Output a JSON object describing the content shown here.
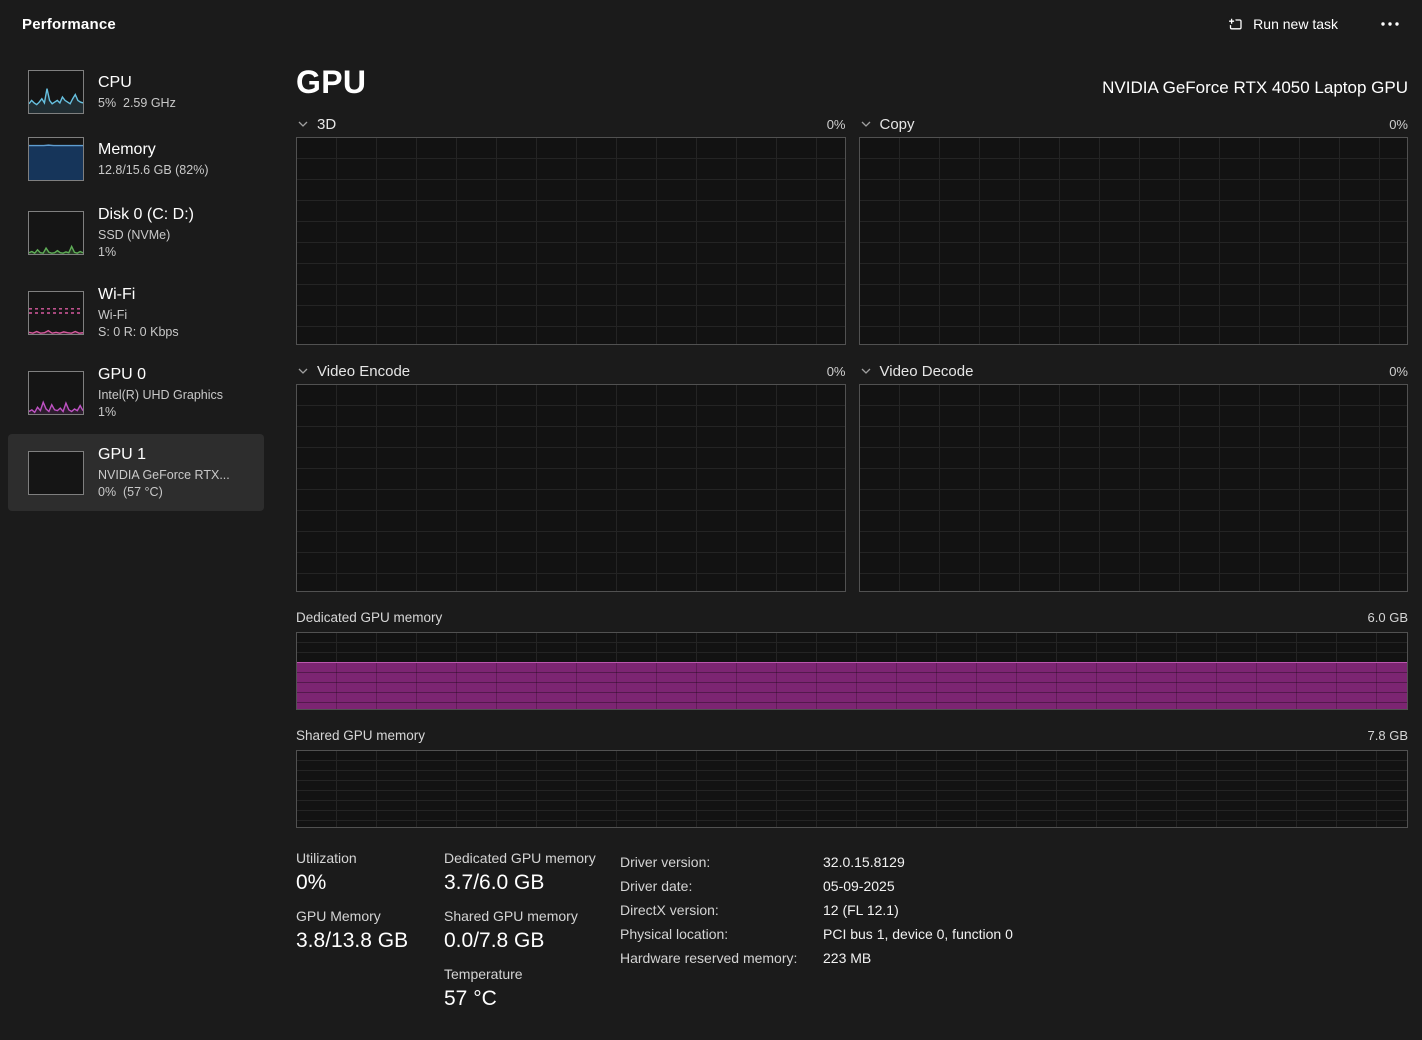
{
  "header": {
    "title": "Performance",
    "run_new_task": "Run new task",
    "run_new_task_icon": "window-plus-icon",
    "more_icon": "ellipsis-icon"
  },
  "sidebar": {
    "items": [
      {
        "id": "cpu",
        "title": "CPU",
        "lines": [
          "5%  2.59 GHz"
        ]
      },
      {
        "id": "memory",
        "title": "Memory",
        "lines": [
          "12.8/15.6 GB (82%)"
        ]
      },
      {
        "id": "disk0",
        "title": "Disk 0 (C: D:)",
        "lines": [
          "SSD (NVMe)",
          "1%"
        ]
      },
      {
        "id": "wifi",
        "title": "Wi-Fi",
        "lines": [
          "Wi-Fi",
          "S: 0 R: 0 Kbps"
        ]
      },
      {
        "id": "gpu0",
        "title": "GPU 0",
        "lines": [
          "Intel(R) UHD Graphics",
          "1%"
        ]
      },
      {
        "id": "gpu1",
        "title": "GPU 1",
        "lines": [
          "NVIDIA GeForce RTX...",
          "0%  (57 °C)"
        ],
        "selected": true
      }
    ]
  },
  "main": {
    "title": "GPU",
    "gpu_name": "NVIDIA GeForce RTX 4050 Laptop GPU",
    "engines": [
      {
        "label": "3D",
        "value": "0%"
      },
      {
        "label": "Copy",
        "value": "0%"
      },
      {
        "label": "Video Encode",
        "value": "0%"
      },
      {
        "label": "Video Decode",
        "value": "0%"
      }
    ],
    "memory": [
      {
        "label": "Dedicated GPU memory",
        "max": "6.0 GB",
        "fill_pct": 62
      },
      {
        "label": "Shared GPU memory",
        "max": "7.8 GB",
        "fill_pct": 0
      }
    ]
  },
  "stats": {
    "utilization": {
      "label": "Utilization",
      "value": "0%"
    },
    "gpu_memory": {
      "label": "GPU Memory",
      "value": "3.8/13.8 GB"
    },
    "dedicated": {
      "label": "Dedicated GPU memory",
      "value": "3.7/6.0 GB"
    },
    "shared": {
      "label": "Shared GPU memory",
      "value": "0.0/7.8 GB"
    },
    "temperature": {
      "label": "Temperature",
      "value": "57 °C"
    },
    "details": [
      {
        "label": "Driver version:",
        "value": "32.0.15.8129"
      },
      {
        "label": "Driver date:",
        "value": "05-09-2025"
      },
      {
        "label": "DirectX version:",
        "value": "12 (FL 12.1)"
      },
      {
        "label": "Physical location:",
        "value": "PCI bus 1, device 0, function 0"
      },
      {
        "label": "Hardware reserved memory:",
        "value": "223 MB"
      }
    ]
  },
  "colors": {
    "dedicated_fill": "#7c2572",
    "dedicated_fill_top": "#bb57ae",
    "cpu_accent": "#67c1e0",
    "memory_accent": "#5f9dd0",
    "disk_accent": "#5fae57",
    "wifi_accent": "#d65a9e",
    "gpu_accent": "#bf52c4"
  },
  "sparklines": {
    "cpu": {
      "series": [
        {
          "values": [
            22,
            30,
            24,
            20,
            26,
            34,
            24,
            58,
            30,
            22,
            26,
            30,
            24,
            38,
            30,
            26,
            22,
            34,
            44,
            30,
            26,
            24
          ],
          "color": "#67c1e0",
          "fill": "rgba(103,193,224,0.14)"
        }
      ]
    },
    "memory": {
      "series": [
        {
          "values": [
            82,
            82,
            82,
            82,
            83,
            82,
            82,
            82,
            82,
            82,
            82,
            82
          ],
          "color": "#5f9dd0",
          "fill": "#16355a"
        }
      ]
    },
    "disk": {
      "series": [
        {
          "values": [
            3,
            6,
            2,
            10,
            3,
            2,
            14,
            4,
            2,
            3,
            8,
            3,
            2,
            5,
            3,
            18,
            4,
            2,
            6,
            3
          ],
          "color": "#5fae57",
          "fill": "rgba(95,174,87,0.22)"
        }
      ]
    },
    "wifi": {
      "series": [
        {
          "values": [
            60,
            60,
            60,
            60,
            60,
            60,
            60,
            60,
            60,
            60
          ],
          "color": "#d65a9e",
          "dash": "3,3"
        },
        {
          "values": [
            50,
            50,
            50,
            50,
            50,
            50,
            50,
            50,
            50,
            50
          ],
          "color": "#d65a9e",
          "dash": "3,3"
        },
        {
          "values": [
            4,
            2,
            6,
            2,
            3,
            8,
            2,
            4,
            2,
            5,
            3,
            2,
            6,
            2,
            3
          ],
          "color": "#d65a9e",
          "fill": "rgba(214,90,158,0.2)"
        }
      ]
    },
    "gpu0": {
      "series": [
        {
          "values": [
            6,
            10,
            4,
            16,
            8,
            28,
            12,
            6,
            22,
            10,
            8,
            14,
            6,
            26,
            10,
            6,
            12,
            8,
            20,
            8
          ],
          "color": "#bf52c4",
          "fill": "rgba(191,82,196,0.15)"
        }
      ]
    },
    "gpu1": {
      "series": []
    }
  },
  "chart_data": [
    {
      "type": "line",
      "title": "3D",
      "ylim": [
        0,
        100
      ],
      "unit": "%",
      "current": 0
    },
    {
      "type": "line",
      "title": "Copy",
      "ylim": [
        0,
        100
      ],
      "unit": "%",
      "current": 0
    },
    {
      "type": "line",
      "title": "Video Encode",
      "ylim": [
        0,
        100
      ],
      "unit": "%",
      "current": 0
    },
    {
      "type": "line",
      "title": "Video Decode",
      "ylim": [
        0,
        100
      ],
      "unit": "%",
      "current": 0
    },
    {
      "type": "area",
      "title": "Dedicated GPU memory",
      "ylim": [
        0,
        6.0
      ],
      "unit": "GB",
      "current": 3.7
    },
    {
      "type": "area",
      "title": "Shared GPU memory",
      "ylim": [
        0,
        7.8
      ],
      "unit": "GB",
      "current": 0.0
    }
  ]
}
